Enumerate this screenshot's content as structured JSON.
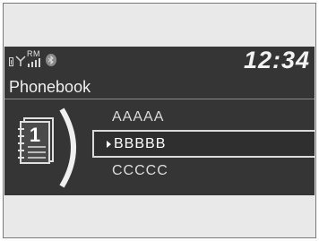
{
  "status": {
    "roam_label": "RM",
    "clock": "12:34"
  },
  "screen": {
    "title": "Phonebook",
    "page_number": "1"
  },
  "contacts": [
    {
      "name": "AAAAA",
      "selected": false
    },
    {
      "name": "BBBBB",
      "selected": true
    },
    {
      "name": "CCCCC",
      "selected": false
    }
  ],
  "colors": {
    "screen_bg": "#353535",
    "text": "#f0f0f0",
    "highlight_border": "#dadada"
  },
  "icons": [
    "battery-icon",
    "signal-icon",
    "bluetooth-icon",
    "phonebook-icon"
  ]
}
